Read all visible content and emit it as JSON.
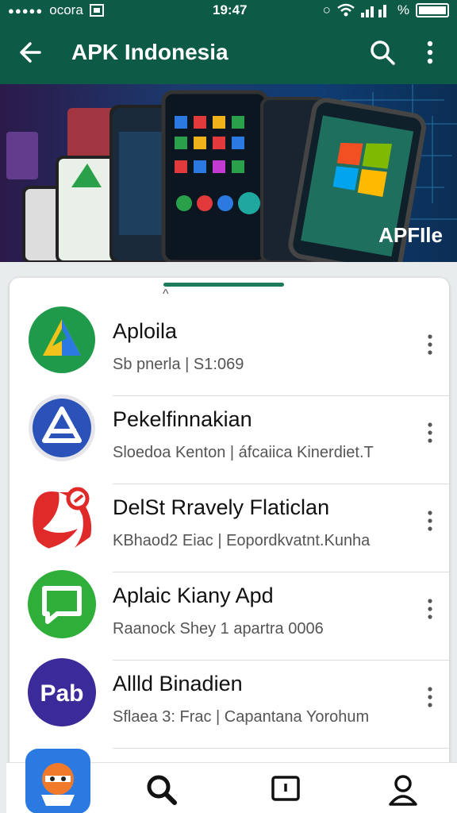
{
  "status_bar": {
    "carrier": "ocora",
    "time": "19:47",
    "battery_label": "%"
  },
  "app_bar": {
    "title": "APK Indonesia"
  },
  "banner": {
    "label": "APFIle"
  },
  "apps": [
    {
      "name": "Aploila",
      "subtitle": "Sb pnerla | S1:069",
      "icon": "green-triangle-icon",
      "color": "#1f9a4a"
    },
    {
      "name": "Pekelfinnakian",
      "subtitle": "Sloedoa Kenton | áfcaiica Kinerdiet.T",
      "icon": "blue-triangle-icon",
      "color": "#2a52b8"
    },
    {
      "name": "DelSt Rravely Flaticlan",
      "subtitle": "KBhaod2 Eiac | Eopordkvatnt.Kunha",
      "icon": "red-swirl-icon",
      "color": "#e02a2a"
    },
    {
      "name": "Aplaic Kiany Apd",
      "subtitle": "Raanock Shey 1 apartra 0006",
      "icon": "chat-bubble-icon",
      "color": "#2fae3a"
    },
    {
      "name": "Allld Binadien",
      "subtitle": "Sflaea 3: Frac | Capantana Yorohum",
      "icon": "pab-icon",
      "color": "#3b2a9a",
      "icon_text": "Pab"
    }
  ],
  "bottom_nav": [
    "search",
    "inbox",
    "profile"
  ]
}
